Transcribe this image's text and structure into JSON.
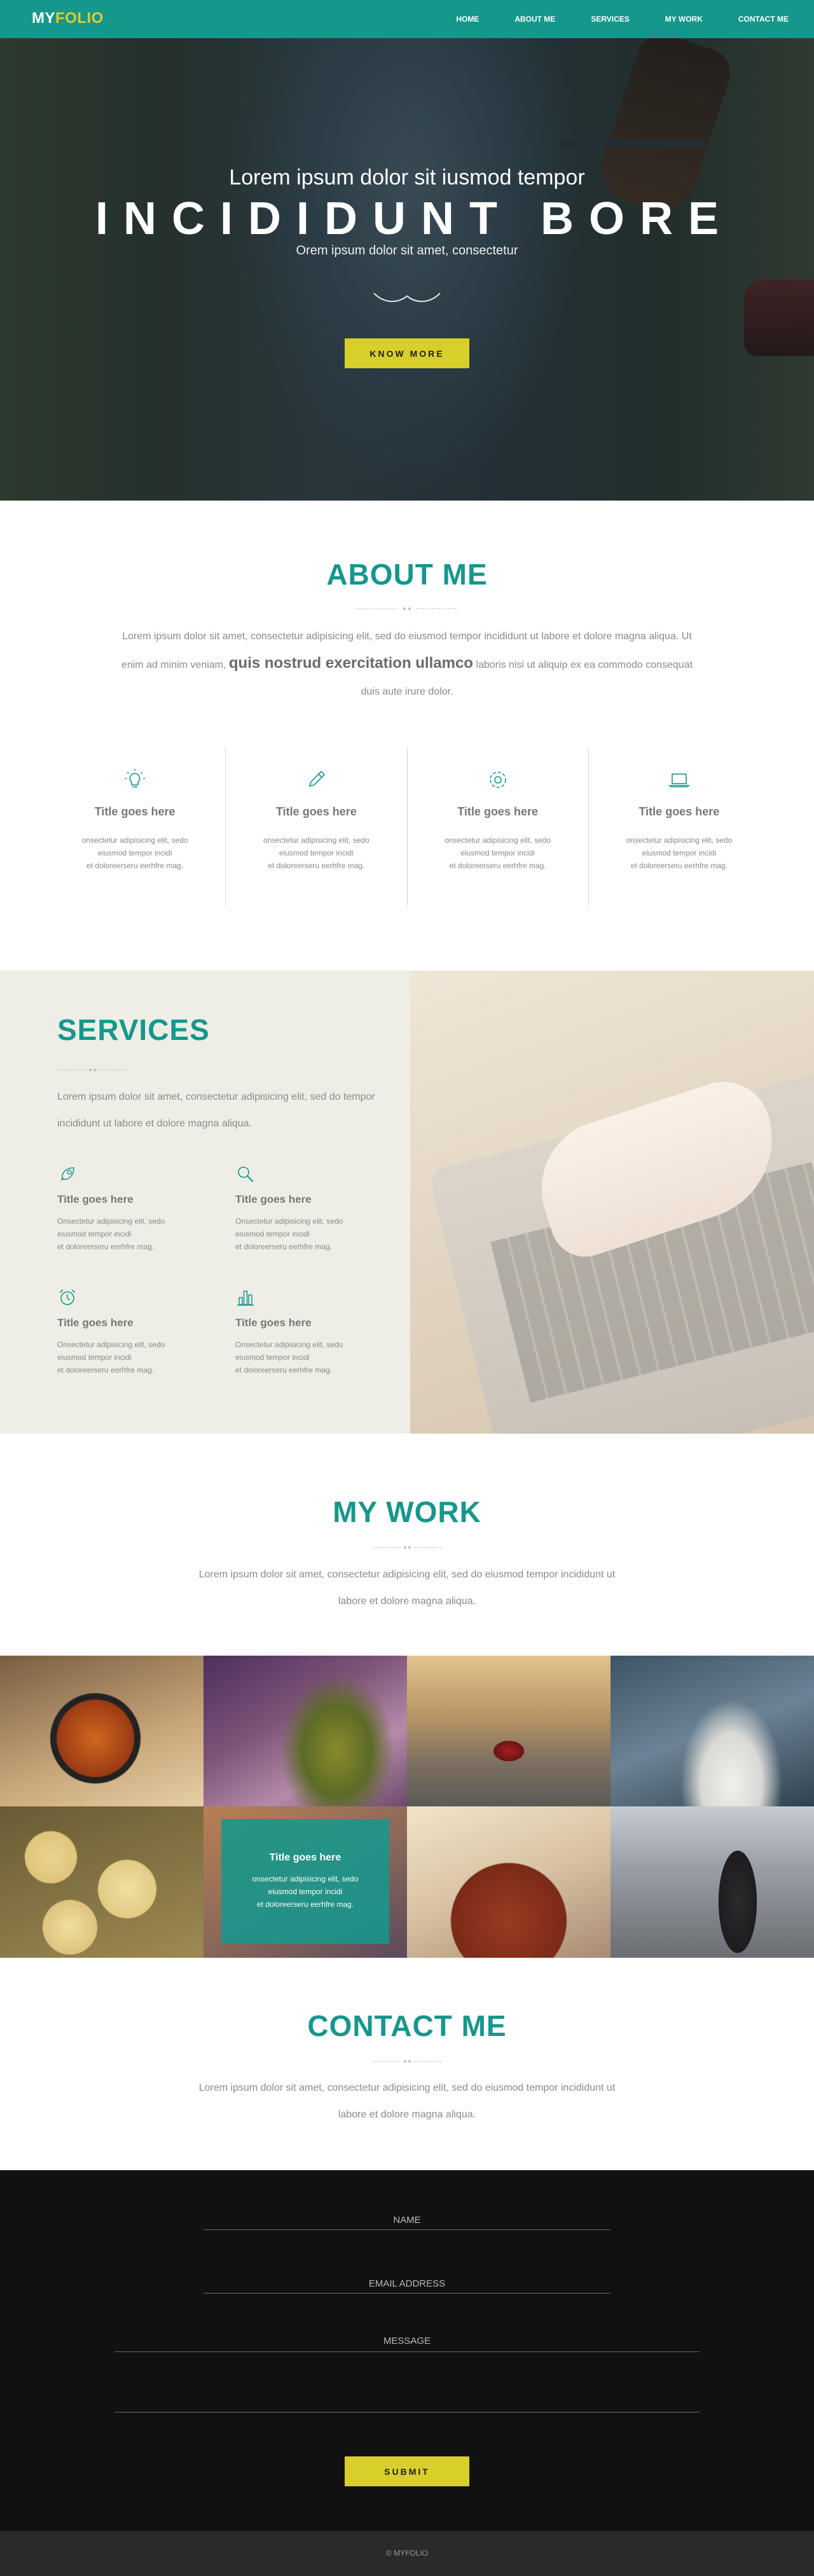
{
  "nav": {
    "logo_my": "MY",
    "logo_folio": "FOLIO",
    "links": [
      "HOME",
      "ABOUT ME",
      "SERVICES",
      "MY WORK",
      "CONTACT ME"
    ]
  },
  "hero": {
    "subtitle": "Lorem ipsum dolor sit iusmod tempor",
    "title": "INCIDIDUNT BORE",
    "tagline": "Orem ipsum dolor sit amet, consectetur",
    "button": "KNOW MORE"
  },
  "about": {
    "title": "ABOUT ME",
    "para_a": "Lorem ipsum dolor sit amet, consectetur adipisicing elit, sed do eiusmod tempor incididunt ut labore et dolore magna aliqua. Ut enim ad minim veniam,",
    "para_strong": "quis nostrud exercitation ullamco",
    "para_b": "laboris nisi ut aliquip ex ea commodo consequat duis aute irure dolor.",
    "features": [
      {
        "icon": "lightbulb-icon",
        "title": "Title goes here",
        "l1": "onsectetur adipisicing elit, sedo",
        "l2": "eiusmod tempor incidi",
        "l3": "et doloreerseru eerhfre mag."
      },
      {
        "icon": "pencil-icon",
        "title": "Title goes here",
        "l1": "onsectetur adipisicing elit, sedo",
        "l2": "eiusmod tempor incidi",
        "l3": "et doloreerseru eerhfre mag."
      },
      {
        "icon": "gear-icon",
        "title": "Title goes here",
        "l1": "onsectetur adipisicing elit, sedo",
        "l2": "eiusmod tempor incidi",
        "l3": "et doloreerseru eerhfre mag."
      },
      {
        "icon": "laptop-icon",
        "title": "Title goes here",
        "l1": "onsectetur adipisicing elit, sedo",
        "l2": "eiusmod tempor incidi",
        "l3": "et doloreerseru eerhfre mag."
      }
    ]
  },
  "services": {
    "title": "SERVICES",
    "para": "Lorem ipsum dolor sit amet, consectetur adipisicing elit, sed do tempor incididunt ut labore et dolore magna aliqua.",
    "items": [
      {
        "icon": "rocket-icon",
        "title": "Title goes here",
        "l1": "Onsectetur adipisicing elit, sedo",
        "l2": "eiusmod tempor incidi",
        "l3": "et doloreerseru eerhfre mag."
      },
      {
        "icon": "search-icon",
        "title": "Title goes here",
        "l1": "Onsectetur adipisicing elit, sedo",
        "l2": "eiusmod tempor incidi",
        "l3": "et doloreerseru eerhfre mag."
      },
      {
        "icon": "alarm-clock-icon",
        "title": "Title goes here",
        "l1": "Onsectetur adipisicing elit, sedo",
        "l2": "eiusmod tempor incidi",
        "l3": "et doloreerseru eerhfre mag."
      },
      {
        "icon": "bar-chart-icon",
        "title": "Title goes here",
        "l1": "Onsectetur adipisicing elit, sedo",
        "l2": "eiusmod tempor incidi",
        "l3": "et doloreerseru eerhfre mag."
      }
    ]
  },
  "work": {
    "title": "MY WORK",
    "para": "Lorem ipsum dolor sit amet, consectetur adipisicing elit, sed do eiusmod tempor incididunt ut labore et dolore magna aliqua.",
    "overlay": {
      "title": "Title goes here",
      "l1": "onsectetur adipisicing elit, sedo",
      "l2": "eiusmod tempor incidi",
      "l3": "et doloreerseru eerhfre mag."
    }
  },
  "contact": {
    "title": "CONTACT ME",
    "para": "Lorem ipsum dolor sit amet, consectetur adipisicing elit, sed do eiusmod tempor incididunt ut labore et dolore magna aliqua.",
    "name_placeholder": "NAME",
    "email_placeholder": "EMAIL ADDRESS",
    "message_placeholder": "MESSAGE",
    "submit": "SUBMIT"
  },
  "footer": {
    "text": "© MYFOLIO"
  },
  "colors": {
    "teal": "#16978c",
    "yellow": "#d8cf2b",
    "dark": "#111111"
  }
}
